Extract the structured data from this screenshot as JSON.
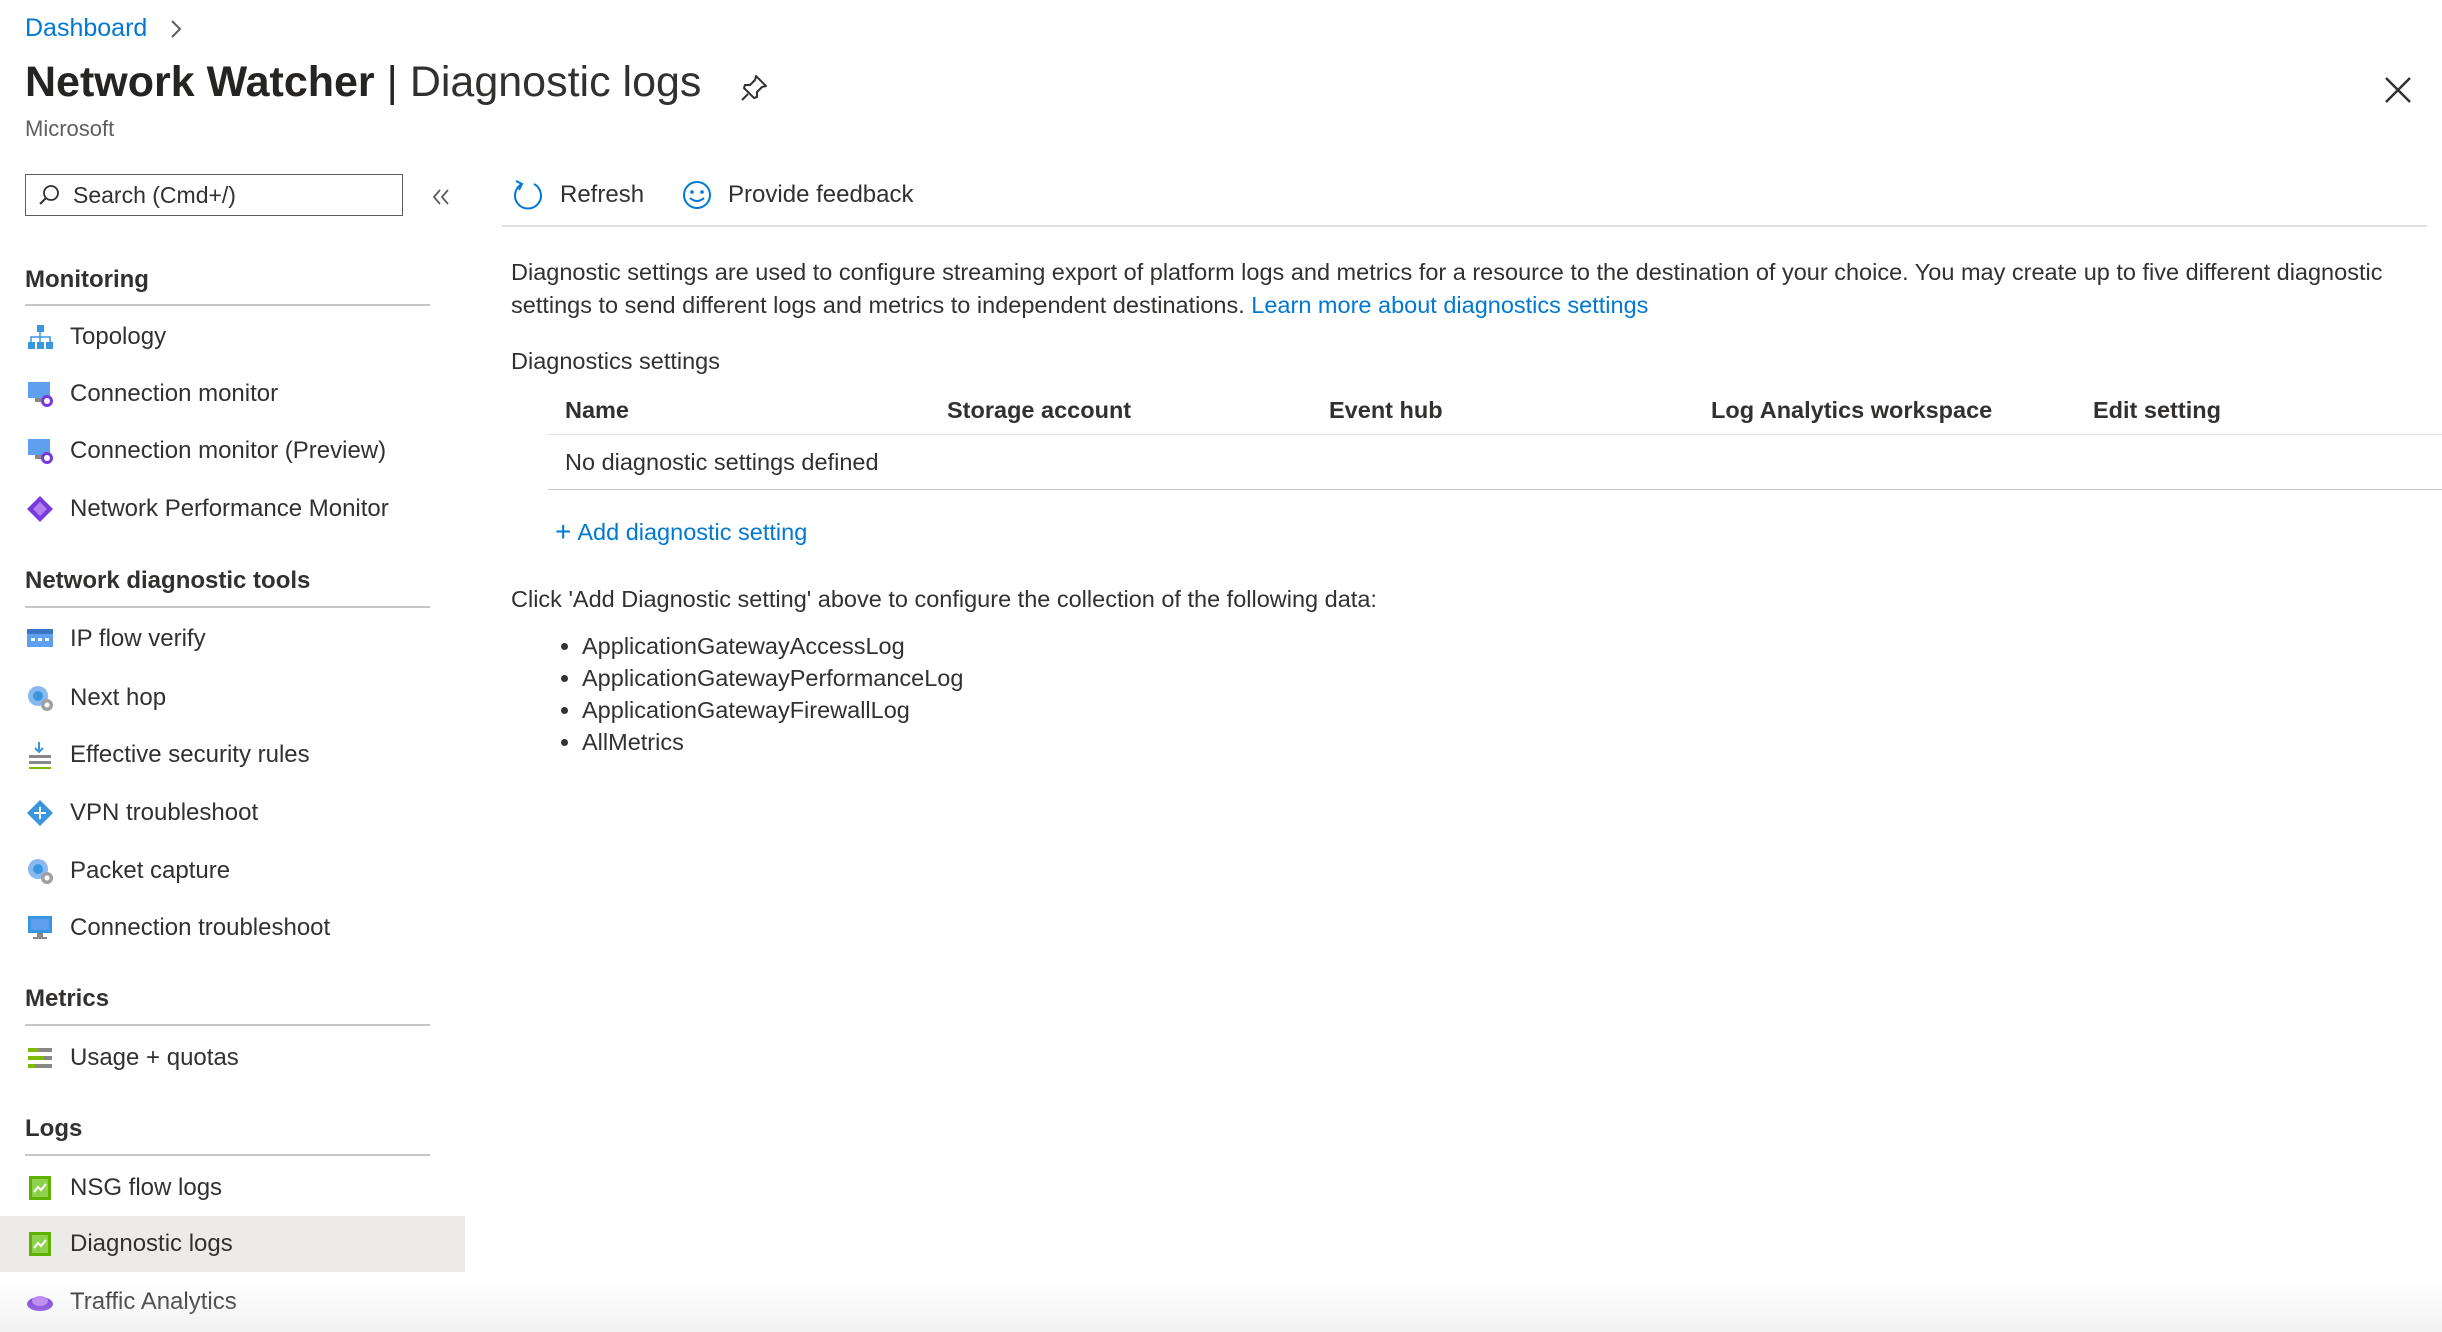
{
  "breadcrumb": {
    "dashboard": "Dashboard"
  },
  "header": {
    "title_bold": "Network Watcher",
    "title_pipe": "|",
    "title_light": "Diagnostic logs",
    "subtitle": "Microsoft"
  },
  "sidebar": {
    "search_placeholder": "Search (Cmd+/)",
    "sections": {
      "monitoring": "Monitoring",
      "network_diagnostic_tools": "Network diagnostic tools",
      "metrics": "Metrics",
      "logs": "Logs"
    },
    "items": {
      "topology": "Topology",
      "connection_monitor": "Connection monitor",
      "connection_monitor_preview": "Connection monitor (Preview)",
      "network_performance_monitor": "Network Performance Monitor",
      "ip_flow_verify": "IP flow verify",
      "next_hop": "Next hop",
      "effective_security_rules": "Effective security rules",
      "vpn_troubleshoot": "VPN troubleshoot",
      "packet_capture": "Packet capture",
      "connection_troubleshoot": "Connection troubleshoot",
      "usage_quotas": "Usage + quotas",
      "nsg_flow_logs": "NSG flow logs",
      "diagnostic_logs": "Diagnostic logs",
      "traffic_analytics": "Traffic Analytics"
    },
    "selected_item": "Diagnostic logs"
  },
  "toolbar": {
    "refresh": "Refresh",
    "provide_feedback": "Provide feedback"
  },
  "content": {
    "description": "Diagnostic settings are used to configure streaming export of platform logs and metrics for a resource to the destination of your choice. You may create up to five different diagnostic settings to send different logs and metrics to independent destinations.",
    "learn_more": "Learn more about diagnostics settings",
    "diagnostics_settings_label": "Diagnostics settings",
    "table": {
      "columns": [
        "Name",
        "Storage account",
        "Event hub",
        "Log Analytics workspace",
        "Edit setting"
      ],
      "empty_message": "No diagnostic settings defined"
    },
    "add_setting_label": "Add diagnostic setting",
    "click_instruction": "Click 'Add Diagnostic setting' above to configure the collection of the following data:",
    "data_items": [
      "ApplicationGatewayAccessLog",
      "ApplicationGatewayPerformanceLog",
      "ApplicationGatewayFirewallLog",
      "AllMetrics"
    ]
  },
  "colors": {
    "link": "#0078d4",
    "text": "#323130",
    "selected_bg": "#edebe9"
  }
}
